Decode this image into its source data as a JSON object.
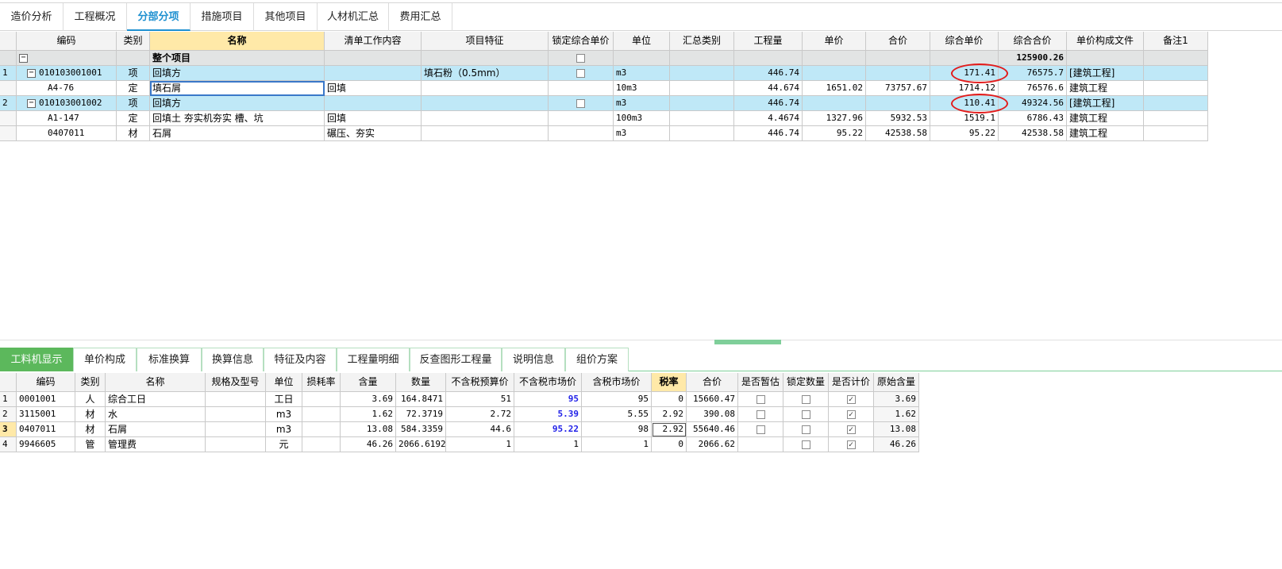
{
  "top_tabs": [
    "造价分析",
    "工程概况",
    "分部分项",
    "措施项目",
    "其他项目",
    "人材机汇总",
    "费用汇总"
  ],
  "top_tab_active": "分部分项",
  "main_table": {
    "headers": [
      "编码",
      "类别",
      "名称",
      "清单工作内容",
      "项目特征",
      "锁定综合单价",
      "单位",
      "汇总类别",
      "工程量",
      "单价",
      "合价",
      "综合单价",
      "综合合价",
      "单价构成文件",
      "备注1"
    ],
    "rows": [
      {
        "num": "",
        "code": "",
        "type": "",
        "name": "整个项目",
        "work": "",
        "feature": "",
        "unit": "",
        "sumcat": "",
        "qty": "",
        "price": "",
        "total": "",
        "cprice": "",
        "ctotal": "125900.26",
        "file": "",
        "note": ""
      },
      {
        "num": "1",
        "code": "010103001001",
        "type": "项",
        "name": "回填方",
        "work": "",
        "feature": "填石粉（0.5mm）",
        "unit": "m3",
        "sumcat": "",
        "qty": "446.74",
        "price": "",
        "total": "",
        "cprice": "171.41",
        "ctotal": "76575.7",
        "file": "[建筑工程]",
        "note": ""
      },
      {
        "num": "",
        "code": "A4-76",
        "type": "定",
        "name": "填石屑",
        "work": "回填",
        "feature": "",
        "unit": "10m3",
        "sumcat": "",
        "qty": "44.674",
        "price": "1651.02",
        "total": "73757.67",
        "cprice": "1714.12",
        "ctotal": "76576.6",
        "file": "建筑工程",
        "note": ""
      },
      {
        "num": "2",
        "code": "010103001002",
        "type": "项",
        "name": "回填方",
        "work": "",
        "feature": "",
        "unit": "m3",
        "sumcat": "",
        "qty": "446.74",
        "price": "",
        "total": "",
        "cprice": "110.41",
        "ctotal": "49324.56",
        "file": "[建筑工程]",
        "note": ""
      },
      {
        "num": "",
        "code": "A1-147",
        "type": "定",
        "name": "回填土 夯实机夯实 槽、坑",
        "work": "回填",
        "feature": "",
        "unit": "100m3",
        "sumcat": "",
        "qty": "4.4674",
        "price": "1327.96",
        "total": "5932.53",
        "cprice": "1519.1",
        "ctotal": "6786.43",
        "file": "建筑工程",
        "note": ""
      },
      {
        "num": "",
        "code": "0407011",
        "type": "材",
        "name": "石屑",
        "work": "碾压、夯实",
        "feature": "",
        "unit": "m3",
        "sumcat": "",
        "qty": "446.74",
        "price": "95.22",
        "total": "42538.58",
        "cprice": "95.22",
        "ctotal": "42538.58",
        "file": "建筑工程",
        "note": ""
      }
    ]
  },
  "bottom_tabs": [
    "工料机显示",
    "单价构成",
    "标准换算",
    "换算信息",
    "特征及内容",
    "工程量明细",
    "反查图形工程量",
    "说明信息",
    "组价方案"
  ],
  "bottom_tab_active": "工料机显示",
  "detail_table": {
    "headers": [
      "编码",
      "类别",
      "名称",
      "规格及型号",
      "单位",
      "损耗率",
      "含量",
      "数量",
      "不含税预算价",
      "不含税市场价",
      "含税市场价",
      "税率",
      "合价",
      "是否暂估",
      "锁定数量",
      "是否计价",
      "原始含量"
    ],
    "rows": [
      {
        "num": "1",
        "code": "0001001",
        "type": "人",
        "name": "综合工日",
        "spec": "",
        "unit": "工日",
        "loss": "",
        "content": "3.69",
        "qty": "164.8471",
        "budget": "51",
        "market": "95",
        "tax_market": "95",
        "tax_rate": "0",
        "total": "15660.47",
        "estimate": false,
        "lock": false,
        "priced": true,
        "orig": "3.69"
      },
      {
        "num": "2",
        "code": "3115001",
        "type": "材",
        "name": "水",
        "spec": "",
        "unit": "m3",
        "loss": "",
        "content": "1.62",
        "qty": "72.3719",
        "budget": "2.72",
        "market": "5.39",
        "tax_market": "5.55",
        "tax_rate": "2.92",
        "total": "390.08",
        "estimate": false,
        "lock": false,
        "priced": true,
        "orig": "1.62"
      },
      {
        "num": "3",
        "code": "0407011",
        "type": "材",
        "name": "石屑",
        "spec": "",
        "unit": "m3",
        "loss": "",
        "content": "13.08",
        "qty": "584.3359",
        "budget": "44.6",
        "market": "95.22",
        "tax_market": "98",
        "tax_rate": "2.92",
        "total": "55640.46",
        "estimate": false,
        "lock": false,
        "priced": true,
        "orig": "13.08"
      },
      {
        "num": "4",
        "code": "9946605",
        "type": "管",
        "name": "管理费",
        "spec": "",
        "unit": "元",
        "loss": "",
        "content": "46.26",
        "qty": "2066.6192",
        "budget": "1",
        "market": "1",
        "tax_market": "1",
        "tax_rate": "0",
        "total": "2066.62",
        "estimate": null,
        "lock": false,
        "priced": true,
        "orig": "46.26"
      }
    ]
  },
  "colors": {
    "accent": "#1e90d0",
    "highlight_row": "#bfe8f7",
    "selected_header": "#ffe9a8",
    "green_tab": "#5cb85c",
    "circle": "#e31b1b"
  }
}
